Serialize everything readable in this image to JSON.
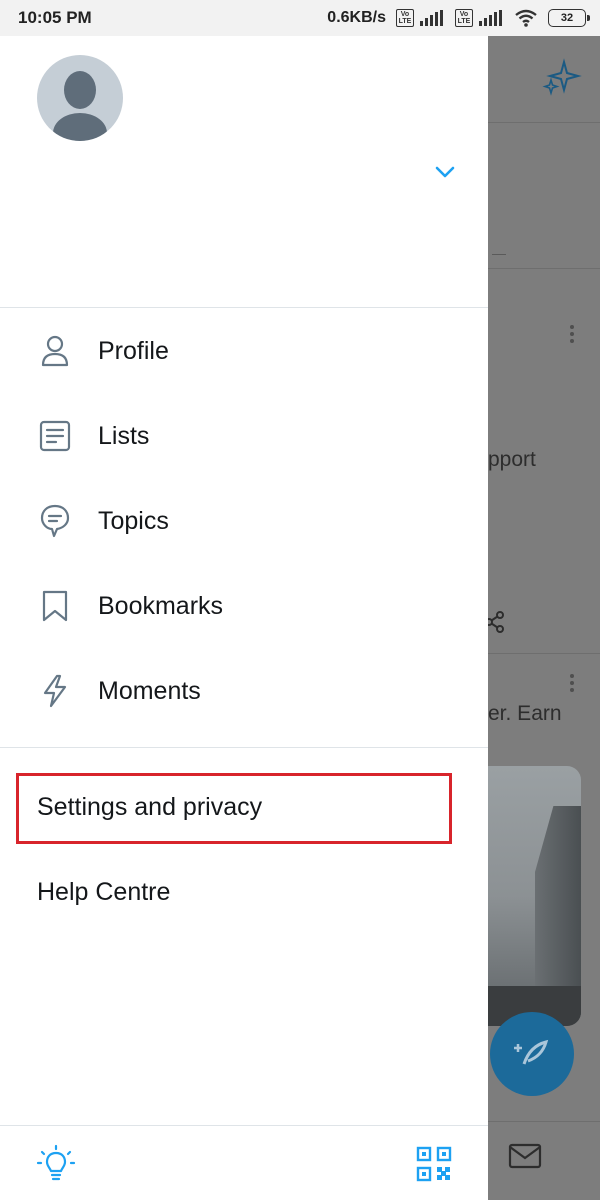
{
  "status_bar": {
    "time": "10:05 PM",
    "network_speed": "0.6KB/s",
    "volte_top": "Vo",
    "volte_bottom": "LTE",
    "battery_level": "32"
  },
  "drawer": {
    "menu_items": [
      {
        "label": "Profile",
        "icon": "person-icon"
      },
      {
        "label": "Lists",
        "icon": "list-icon"
      },
      {
        "label": "Topics",
        "icon": "topics-icon"
      },
      {
        "label": "Bookmarks",
        "icon": "bookmark-icon"
      },
      {
        "label": "Moments",
        "icon": "lightning-icon"
      }
    ],
    "secondary_items": [
      {
        "label": "Settings and privacy",
        "highlighted": true
      },
      {
        "label": "Help Centre"
      }
    ],
    "bottom_icons": [
      "lightbulb-icon",
      "qr-code-icon"
    ]
  },
  "background_app": {
    "text_fragments": [
      "pport",
      "er. Earn"
    ]
  },
  "colors": {
    "accent": "#1da1f2",
    "icon_gray": "#657786",
    "highlight_box": "#d8242b",
    "overlay": "#7d7d7d"
  }
}
